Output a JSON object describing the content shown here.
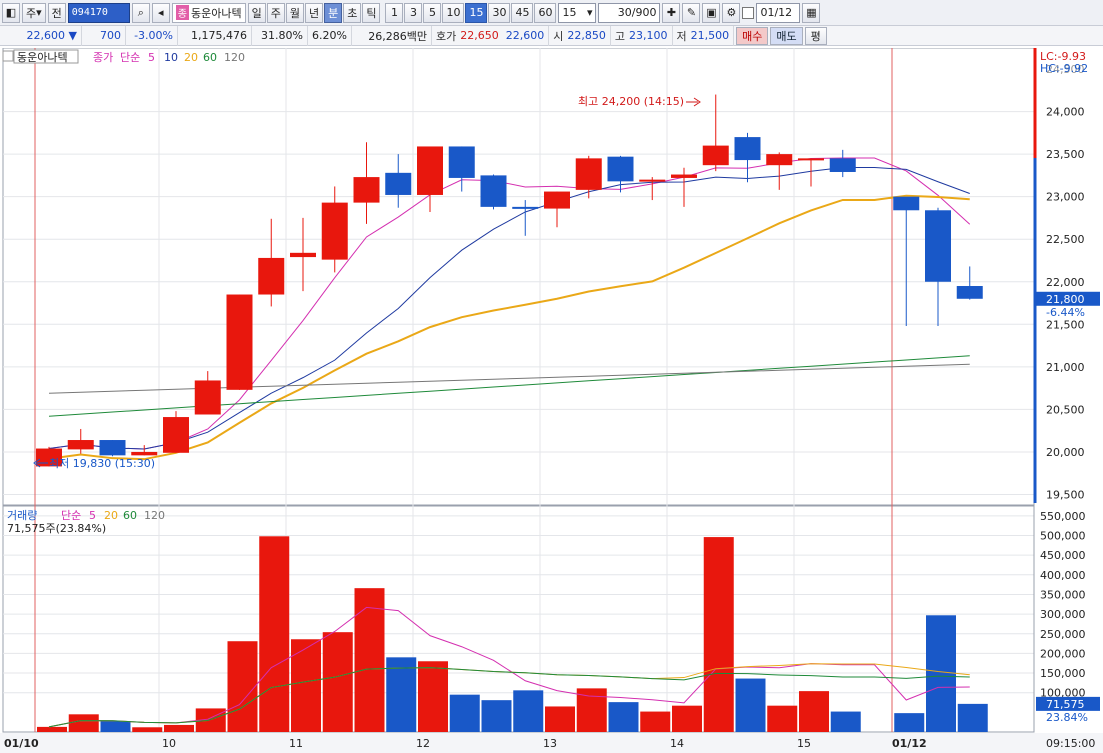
{
  "toolbar": {
    "market": "주",
    "prev_label": "전",
    "code": "094170",
    "stock_tag": "종",
    "stock_name": "동운아나텍",
    "periods": [
      "일",
      "주",
      "월",
      "년",
      "분",
      "초",
      "틱"
    ],
    "active_period": "분",
    "intervals": [
      "1",
      "3",
      "5",
      "10",
      "15",
      "30",
      "45",
      "60"
    ],
    "active_interval": "15",
    "interval_select": "15",
    "count": "30/900",
    "date": "01/12"
  },
  "quote": {
    "price": "22,600",
    "change": "700",
    "change_pct": "-3.00%",
    "volume": "1,175,476",
    "vol_ratio": "31.80%",
    "turnover": "6.20%",
    "amount": "26,286백만",
    "ask_label": "호가",
    "ask": "22,650",
    "bid": "22,600",
    "open_label": "시",
    "open": "22,850",
    "high_label": "고",
    "high": "23,100",
    "low_label": "저",
    "low": "21,500",
    "buy_btn": "매수",
    "sell_btn": "매도",
    "eval_btn": "평"
  },
  "price_panel": {
    "legend_name": "동운아나텍",
    "legend_close": "종가",
    "legend_ma": "단순",
    "ma_periods": [
      "5",
      "10",
      "20",
      "60",
      "120"
    ],
    "lc": "LC:-9.93",
    "hc": "HC:-9.92",
    "high_annot": "최고 24,200 (14:15)",
    "low_annot": "최저 19,830 (15:30)",
    "last_price": "21,800",
    "last_pct": "-6.44%",
    "yticks": [
      "24,000",
      "23,500",
      "23,000",
      "22,500",
      "22,000",
      "21,500",
      "21,000",
      "20,500",
      "20,000",
      "19,500"
    ],
    "top_tick": "24,500"
  },
  "volume_panel": {
    "legend_name": "거래량",
    "legend_ma": "단순",
    "ma_periods": [
      "5",
      "20",
      "60",
      "120"
    ],
    "current": "71,575주(23.84%)",
    "last_vol": "71,575",
    "last_pct": "23.84%",
    "yticks": [
      "550,000",
      "500,000",
      "450,000",
      "400,000",
      "350,000",
      "300,000",
      "250,000",
      "200,000",
      "150,000",
      "100,000"
    ]
  },
  "xaxis": {
    "labels": [
      "01/10",
      "10",
      "11",
      "12",
      "13",
      "14",
      "15",
      "01/12"
    ],
    "time": "09:15:00"
  },
  "colors": {
    "up": "#e8170d",
    "down": "#1958c8",
    "ma5": "#d42fb0",
    "ma10": "#1f3aa0",
    "ma20": "#eaa817",
    "ma60": "#1f8a3a",
    "ma120": "#777777"
  },
  "chart_data": {
    "type": "candlestick",
    "candles": [
      {
        "o": 19830,
        "c": 20040,
        "h": 20060,
        "l": 19830
      },
      {
        "o": 20030,
        "c": 20140,
        "h": 20270,
        "l": 19980
      },
      {
        "o": 20140,
        "c": 19960,
        "h": 20140,
        "l": 19950
      },
      {
        "o": 19960,
        "c": 20000,
        "h": 20080,
        "l": 19960
      },
      {
        "o": 19990,
        "c": 20410,
        "h": 20480,
        "l": 19990
      },
      {
        "o": 20440,
        "c": 20840,
        "h": 20950,
        "l": 20440
      },
      {
        "o": 20730,
        "c": 21850,
        "h": 21850,
        "l": 20730
      },
      {
        "o": 21850,
        "c": 22280,
        "h": 22740,
        "l": 21710
      },
      {
        "o": 22290,
        "c": 22340,
        "h": 22750,
        "l": 21890
      },
      {
        "o": 22260,
        "c": 22930,
        "h": 23120,
        "l": 22110
      },
      {
        "o": 22930,
        "c": 23230,
        "h": 23640,
        "l": 22680
      },
      {
        "o": 23280,
        "c": 23020,
        "h": 23500,
        "l": 22870
      },
      {
        "o": 23020,
        "c": 23590,
        "h": 23590,
        "l": 22820
      },
      {
        "o": 23590,
        "c": 23220,
        "h": 23590,
        "l": 23060
      },
      {
        "o": 23250,
        "c": 22880,
        "h": 23260,
        "l": 22850
      },
      {
        "o": 22880,
        "c": 22860,
        "h": 22960,
        "l": 22540
      },
      {
        "o": 22860,
        "c": 23060,
        "h": 23060,
        "l": 22640
      },
      {
        "o": 23080,
        "c": 23450,
        "h": 23480,
        "l": 22980
      },
      {
        "o": 23470,
        "c": 23180,
        "h": 23480,
        "l": 23050
      },
      {
        "o": 23180,
        "c": 23200,
        "h": 23230,
        "l": 22960
      },
      {
        "o": 23220,
        "c": 23260,
        "h": 23340,
        "l": 22880
      },
      {
        "o": 23370,
        "c": 23600,
        "h": 24200,
        "l": 23300
      },
      {
        "o": 23700,
        "c": 23430,
        "h": 23750,
        "l": 23170
      },
      {
        "o": 23370,
        "c": 23500,
        "h": 23520,
        "l": 23080
      },
      {
        "o": 23450,
        "c": 23450,
        "h": 23450,
        "l": 23120
      },
      {
        "o": 23450,
        "c": 23290,
        "h": 23550,
        "l": 23230
      },
      {
        "o": null,
        "c": null,
        "h": null,
        "l": null
      },
      {
        "o": 23000,
        "c": 22840,
        "h": 22900,
        "l": 21480
      },
      {
        "o": 22840,
        "c": 22000,
        "h": 22870,
        "l": 21480
      },
      {
        "o": 21950,
        "c": 21800,
        "h": 22180,
        "l": 21790
      }
    ],
    "volumes": [
      13000,
      45000,
      28000,
      12000,
      18000,
      60000,
      231000,
      498000,
      236000,
      254000,
      366000,
      190000,
      180000,
      95000,
      81000,
      106000,
      65000,
      111000,
      76000,
      52000,
      67000,
      496000,
      136000,
      67000,
      104000,
      52000,
      0,
      48000,
      297000,
      71575
    ],
    "ylim_price": [
      19400,
      24700
    ],
    "ylim_volume": [
      0,
      570000
    ]
  }
}
